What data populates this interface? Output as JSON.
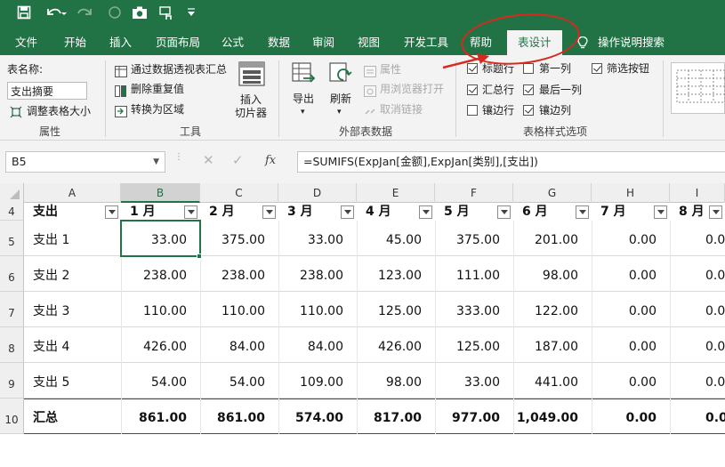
{
  "quick_access": {
    "save_icon": "save-icon",
    "undo_icon": "undo-icon",
    "redo_icon": "redo-icon",
    "camera_icon": "camera-icon",
    "touch_icon": "touch-mode-icon",
    "customize_icon": "customize-icon"
  },
  "tabs": [
    "文件",
    "开始",
    "插入",
    "页面布局",
    "公式",
    "数据",
    "审阅",
    "视图",
    "开发工具",
    "帮助",
    "表设计",
    "操作说明搜索"
  ],
  "ribbon": {
    "properties": {
      "tablename_label": "表名称:",
      "tablename_value": "支出摘要",
      "resize_label": "调整表格大小",
      "group_label": "属性"
    },
    "tools": {
      "pivot": "通过数据透视表汇总",
      "remove_dup": "删除重复值",
      "convert": "转换为区域",
      "slicer_line1": "插入",
      "slicer_line2": "切片器",
      "group_label": "工具"
    },
    "external": {
      "export": "导出",
      "refresh": "刷新",
      "properties": "属性",
      "open_browser": "用浏览器打开",
      "unlink": "取消链接",
      "group_label": "外部表数据"
    },
    "style_options": {
      "group_label": "表格样式选项",
      "options": [
        {
          "label": "标题行",
          "checked": true
        },
        {
          "label": "第一列",
          "checked": false
        },
        {
          "label": "筛选按钮",
          "checked": true
        },
        {
          "label": "汇总行",
          "checked": true
        },
        {
          "label": "最后一列",
          "checked": true
        },
        {
          "label": "镶边行",
          "checked": false
        },
        {
          "label": "镶边列",
          "checked": true
        }
      ]
    }
  },
  "formula_bar": {
    "name_box": "B5",
    "formula": "=SUMIFS(ExpJan[金额],ExpJan[类别],[支出])",
    "cancel_icon": "✕",
    "enter_icon": "✓",
    "fx_label": "fx"
  },
  "sheet": {
    "columns": [
      "A",
      "B",
      "C",
      "D",
      "E",
      "F",
      "G",
      "H",
      "I"
    ],
    "header_row": {
      "num": "4",
      "cells": [
        "支出",
        "1 月",
        "2 月",
        "3 月",
        "4 月",
        "5 月",
        "6 月",
        "7 月",
        "8 月"
      ]
    },
    "rows": [
      {
        "num": "5",
        "cells": [
          "支出 1",
          "33.00",
          "375.00",
          "33.00",
          "45.00",
          "375.00",
          "201.00",
          "0.00",
          "0.0"
        ]
      },
      {
        "num": "6",
        "cells": [
          "支出 2",
          "238.00",
          "238.00",
          "238.00",
          "123.00",
          "111.00",
          "98.00",
          "0.00",
          "0.0"
        ]
      },
      {
        "num": "7",
        "cells": [
          "支出 3",
          "110.00",
          "110.00",
          "110.00",
          "125.00",
          "333.00",
          "122.00",
          "0.00",
          "0.0"
        ]
      },
      {
        "num": "8",
        "cells": [
          "支出 4",
          "426.00",
          "84.00",
          "84.00",
          "426.00",
          "125.00",
          "187.00",
          "0.00",
          "0.0"
        ]
      },
      {
        "num": "9",
        "cells": [
          "支出 5",
          "54.00",
          "54.00",
          "109.00",
          "98.00",
          "33.00",
          "441.00",
          "0.00",
          "0.0"
        ]
      }
    ],
    "total_row": {
      "num": "10",
      "cells": [
        "汇总",
        "861.00",
        "861.00",
        "574.00",
        "817.00",
        "977.00",
        "1,049.00",
        "0.00",
        "0.0"
      ]
    }
  },
  "colors": {
    "accent": "#217346",
    "annotation": "#d9281c"
  }
}
